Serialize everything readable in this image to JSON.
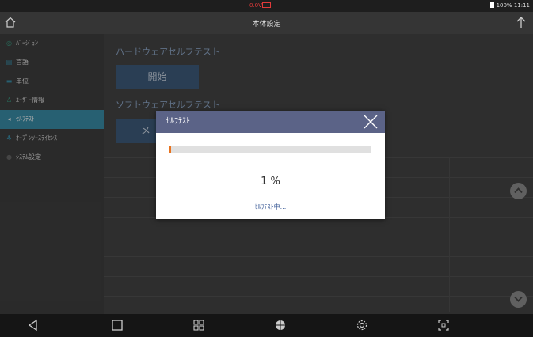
{
  "status_bar": {
    "voltage": "0.0V",
    "battery": "100%",
    "time": "11:11"
  },
  "header": {
    "title": "本体設定"
  },
  "sidebar": {
    "items": [
      {
        "label": "ﾊﾞｰｼﾞｮﾝ",
        "icon": "version-icon"
      },
      {
        "label": "言語",
        "icon": "language-icon"
      },
      {
        "label": "単位",
        "icon": "unit-icon"
      },
      {
        "label": "ﾕｰｻﾞｰ情報",
        "icon": "user-icon"
      },
      {
        "label": "ｾﾙﾌﾃｽﾄ",
        "icon": "selftest-icon"
      },
      {
        "label": "ｵｰﾌﾟﾝｿｰｽﾗｲｾﾝｽ",
        "icon": "license-icon"
      },
      {
        "label": "ｼｽﾃﾑ設定",
        "icon": "system-icon"
      }
    ],
    "active_index": 4
  },
  "main": {
    "hardware_title": "ハードウェアセルフテスト",
    "start_button": "開始",
    "software_title": "ソフトウェアセルフテスト",
    "software_button": "メ"
  },
  "dialog": {
    "title": "ｾﾙﾌﾃｽﾄ",
    "progress": 0.01,
    "percent_text": "1 %",
    "message": "ｾﾙﾌﾃｽﾄ中..."
  },
  "colors": {
    "accent": "#3a8ea8",
    "dialog_header": "#5b6387",
    "progress": "#e8731f",
    "alert": "#e03a3a"
  }
}
